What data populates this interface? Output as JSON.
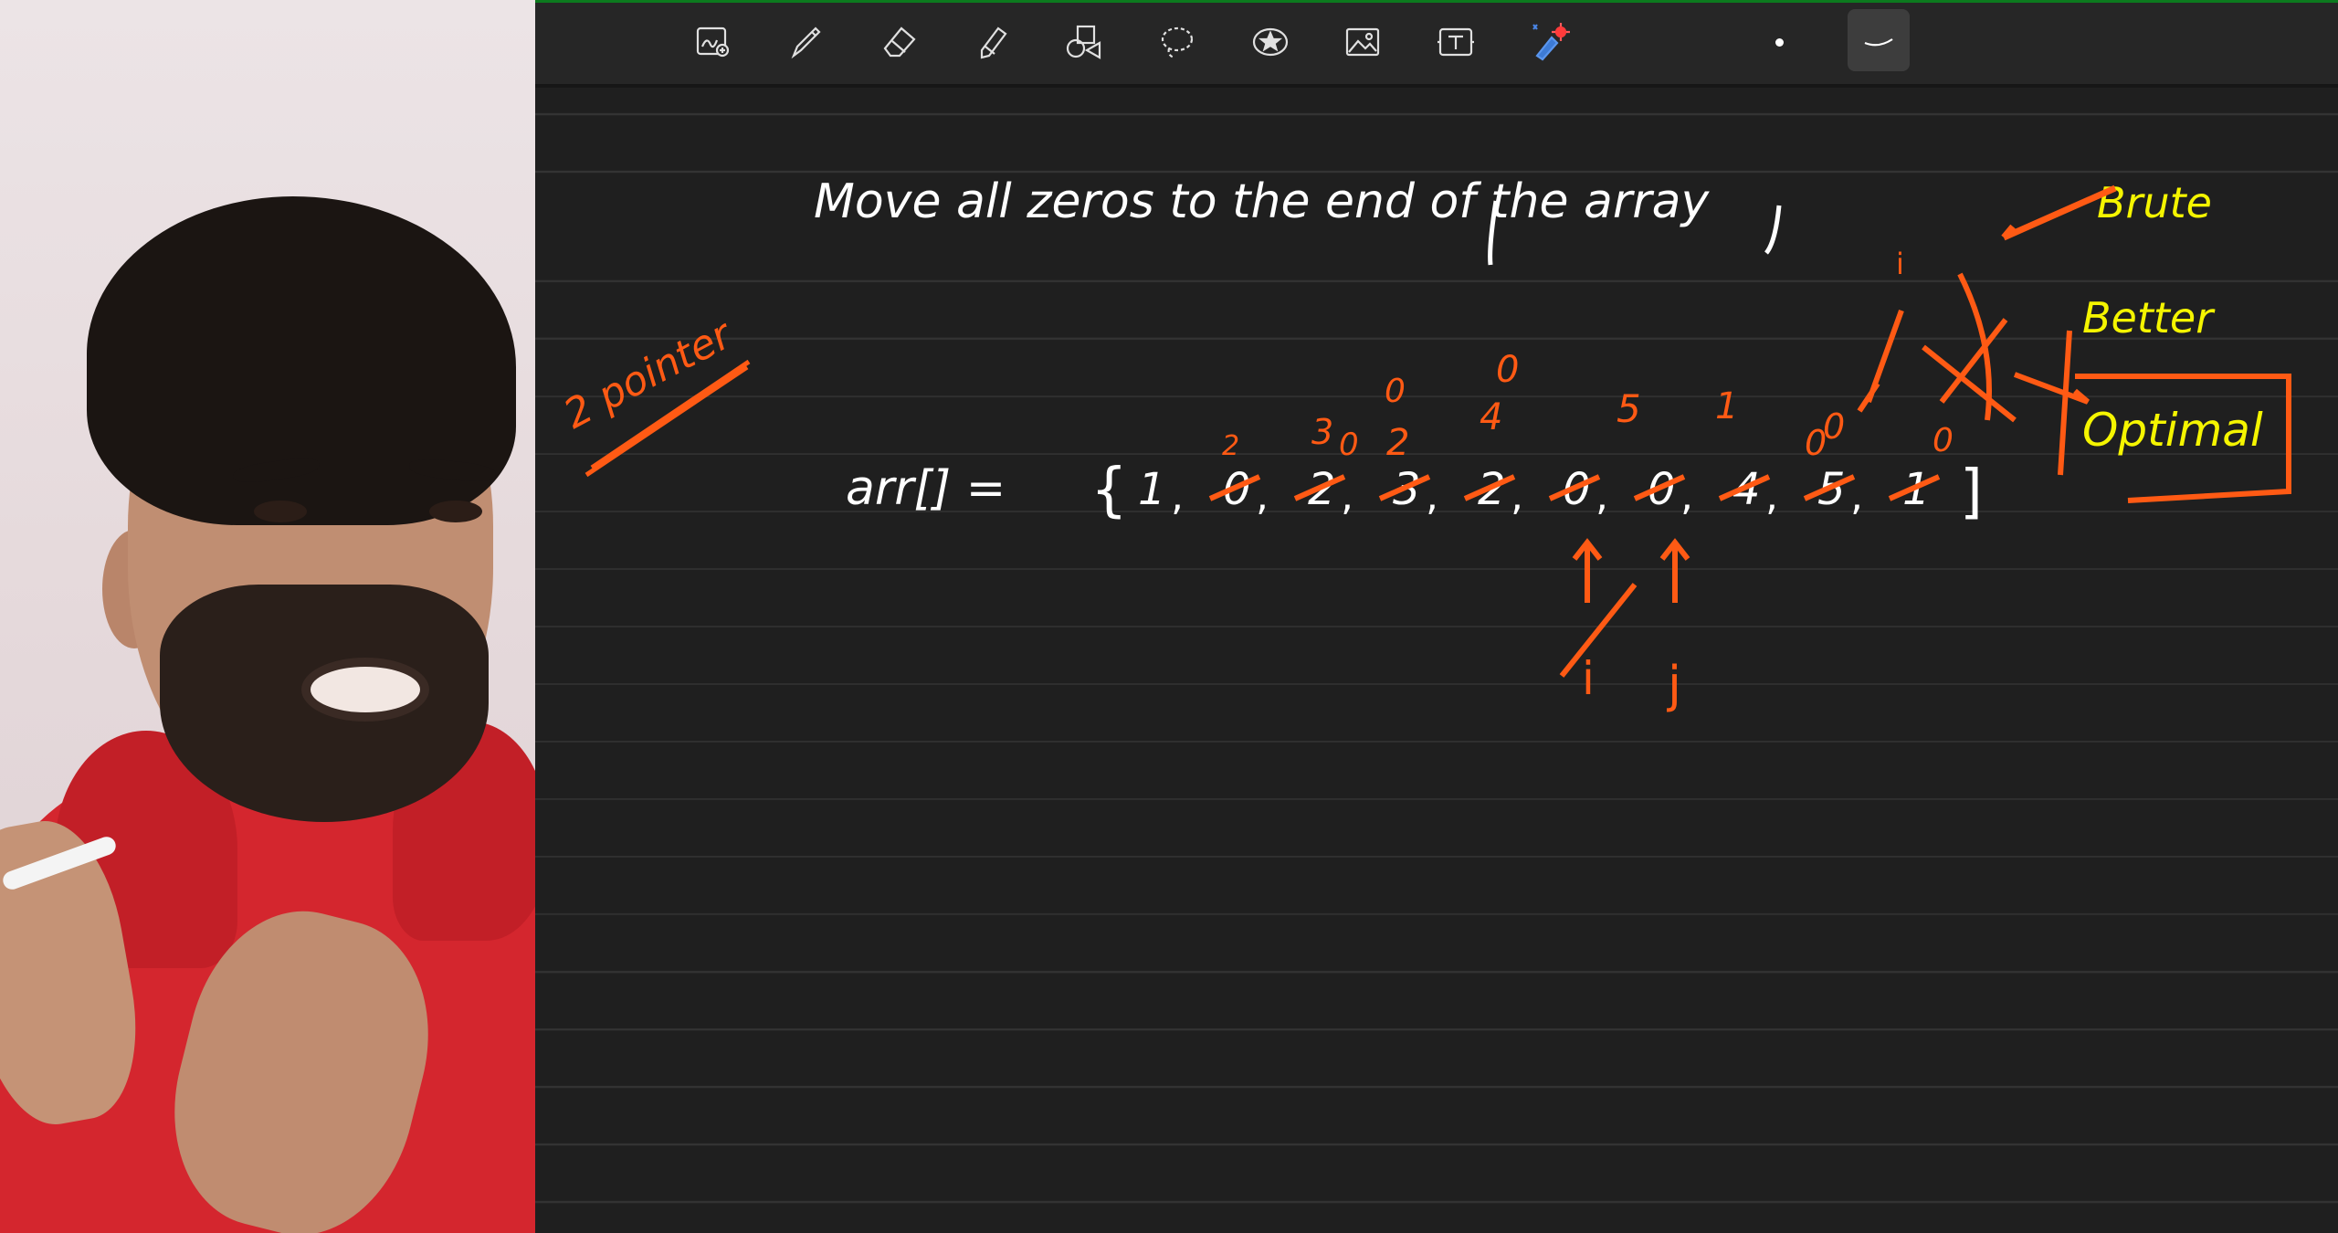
{
  "toolbar": {
    "tools": [
      {
        "name": "zoom-write-icon"
      },
      {
        "name": "pen-icon"
      },
      {
        "name": "eraser-icon"
      },
      {
        "name": "highlighter-icon"
      },
      {
        "name": "shapes-icon"
      },
      {
        "name": "lasso-icon"
      },
      {
        "name": "sticker-icon"
      },
      {
        "name": "image-icon"
      },
      {
        "name": "text-icon"
      },
      {
        "name": "laser-pointer-icon"
      },
      {
        "name": "size-dot"
      },
      {
        "name": "stroke-style-icon"
      }
    ],
    "colors": {
      "accent": "#0c7a1e",
      "active_tool_bg": "#3d3d3d"
    }
  },
  "notes": {
    "title": "Move all zeros to the end of the array",
    "side_note": "2 pointer",
    "approaches": [
      "Brute",
      "Better",
      "Optimal"
    ],
    "array_label": "arr[] =",
    "array_open": "{",
    "array_values": [
      "1",
      "0",
      "2",
      "3",
      "2",
      "0",
      "0",
      "4",
      "5",
      "1"
    ],
    "array_close": "]",
    "overwrites": [
      "2",
      "3",
      "0",
      "2",
      "0",
      "4",
      "0",
      "5",
      "1",
      "0",
      "0",
      "0"
    ],
    "pointers": [
      "i",
      "j"
    ],
    "colors": {
      "white_ink": "#ffffff",
      "orange_ink": "#ff5a14",
      "yellow_ink": "#f5f500"
    }
  }
}
